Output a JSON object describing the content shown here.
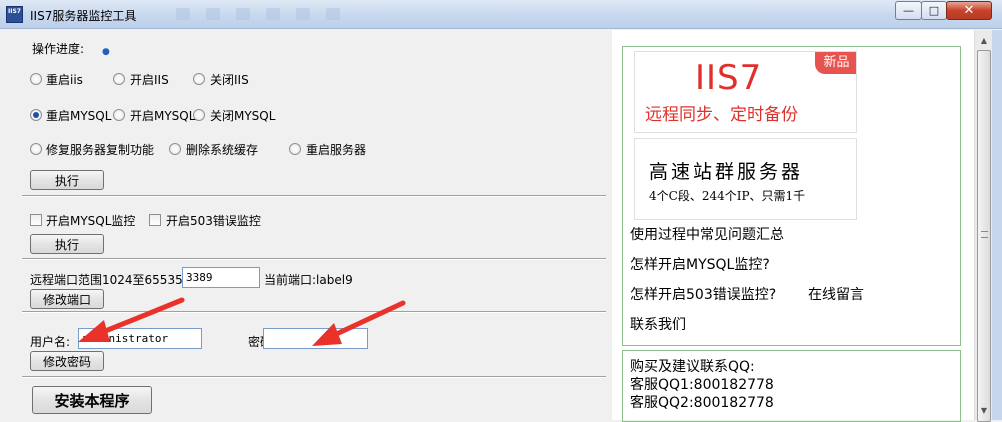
{
  "window": {
    "title": "IIS7服务器监控工具",
    "icon_text": "IIS7",
    "minimize": "—",
    "maximize": "□",
    "close": "✕"
  },
  "progress": {
    "label": "操作进度:"
  },
  "radios_row1": [
    {
      "label": "重启iis",
      "selected": false
    },
    {
      "label": "开启IIS",
      "selected": false
    },
    {
      "label": "关闭IIS",
      "selected": false
    }
  ],
  "radios_row2": [
    {
      "label": "重启MYSQL",
      "selected": true
    },
    {
      "label": "开启MYSQL",
      "selected": false
    },
    {
      "label": "关闭MYSQL",
      "selected": false
    }
  ],
  "radios_row3": [
    {
      "label": "修复服务器复制功能",
      "selected": false
    },
    {
      "label": "删除系统缓存",
      "selected": false
    },
    {
      "label": "重启服务器",
      "selected": false
    }
  ],
  "execute_label": "执行",
  "checks": [
    {
      "label": "开启MYSQL监控",
      "checked": false
    },
    {
      "label": "开启503错误监控",
      "checked": false
    }
  ],
  "port": {
    "range_label": "远程端口范围1024至65535",
    "value": "3389",
    "current_label": "当前端口:label9",
    "modify_label": "修改端口"
  },
  "account": {
    "user_label": "用户名:",
    "user_value": "administrator",
    "pass_label": "密码:",
    "pass_value": "",
    "modify_label": "修改密码"
  },
  "install_label": "安装本程序",
  "ads": {
    "ad1_logo": "IIS7",
    "ad1_tag": "新品",
    "ad1_sub": "远程同步、定时备份",
    "ad2_title": "高速站群服务器",
    "ad2_sub": "4个C段、244个IP、只需1千"
  },
  "links": {
    "faq": "使用过程中常见问题汇总",
    "mysql": "怎样开启MYSQL监控?",
    "err503": "怎样开启503错误监控?",
    "message": "在线留言",
    "contact": "联系我们"
  },
  "contact": {
    "heading": "购买及建议联系QQ:",
    "qq1": "客服QQ1:800182778",
    "qq2": "客服QQ2:800182778"
  },
  "colors": {
    "accent_red": "#e0302a",
    "annotation_arrow": "#e8322a"
  }
}
